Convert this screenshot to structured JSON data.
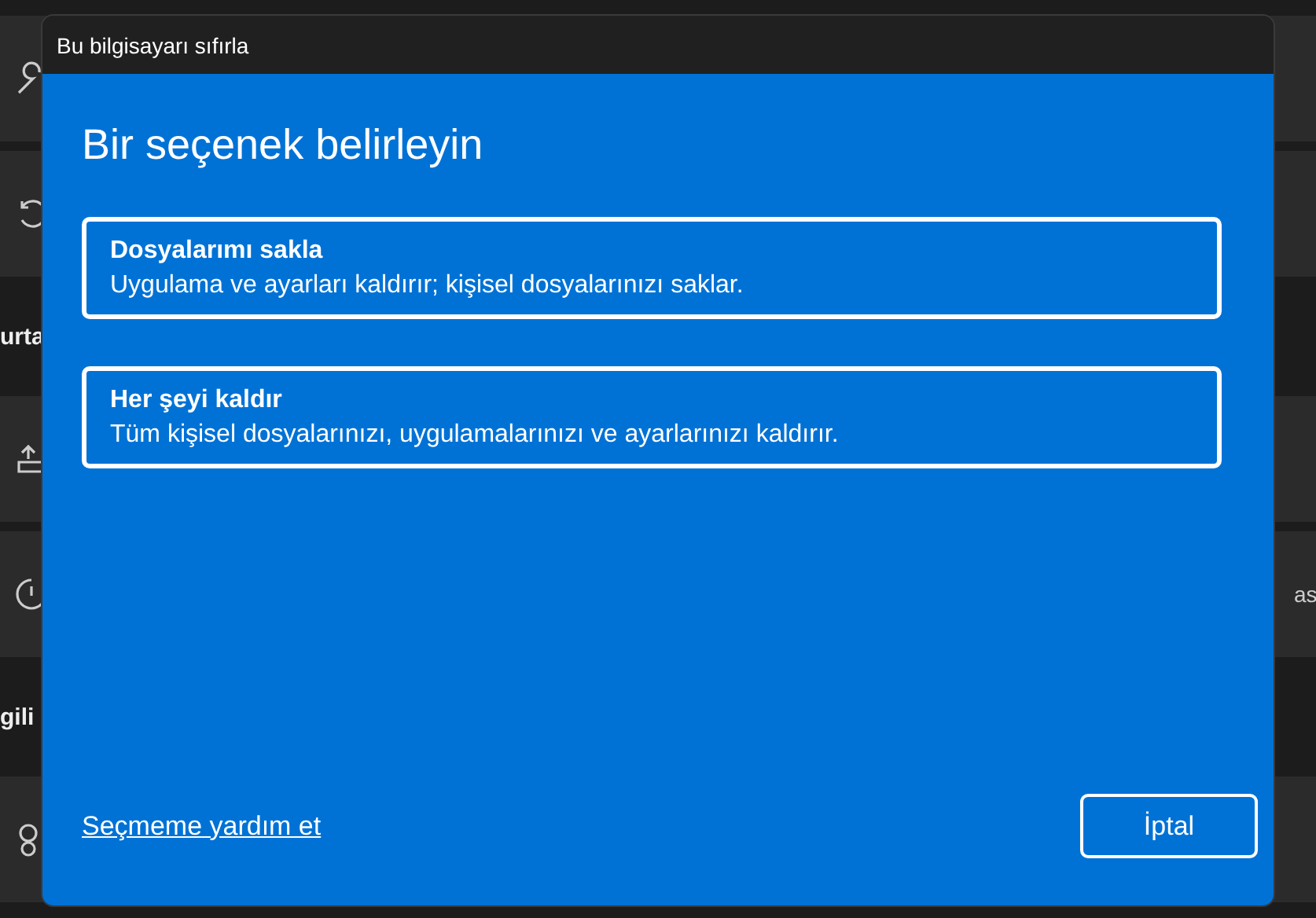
{
  "background": {
    "rows": [
      {
        "kind": "card"
      },
      {
        "kind": "card"
      },
      {
        "kind": "header",
        "text": "urta"
      },
      {
        "kind": "card"
      },
      {
        "kind": "card",
        "trailing": "as"
      },
      {
        "kind": "header",
        "text": "gili"
      },
      {
        "kind": "card"
      }
    ]
  },
  "dialog": {
    "title": "Bu bilgisayarı sıfırla",
    "heading": "Bir seçenek belirleyin",
    "options": [
      {
        "title": "Dosyalarımı sakla",
        "description": "Uygulama ve ayarları kaldırır; kişisel dosyalarınızı saklar."
      },
      {
        "title": "Her şeyi kaldır",
        "description": "Tüm kişisel dosyalarınızı, uygulamalarınızı ve ayarlarınızı kaldırır."
      }
    ],
    "help_link": "Seçmeme yardım et",
    "cancel_button": "İptal"
  }
}
